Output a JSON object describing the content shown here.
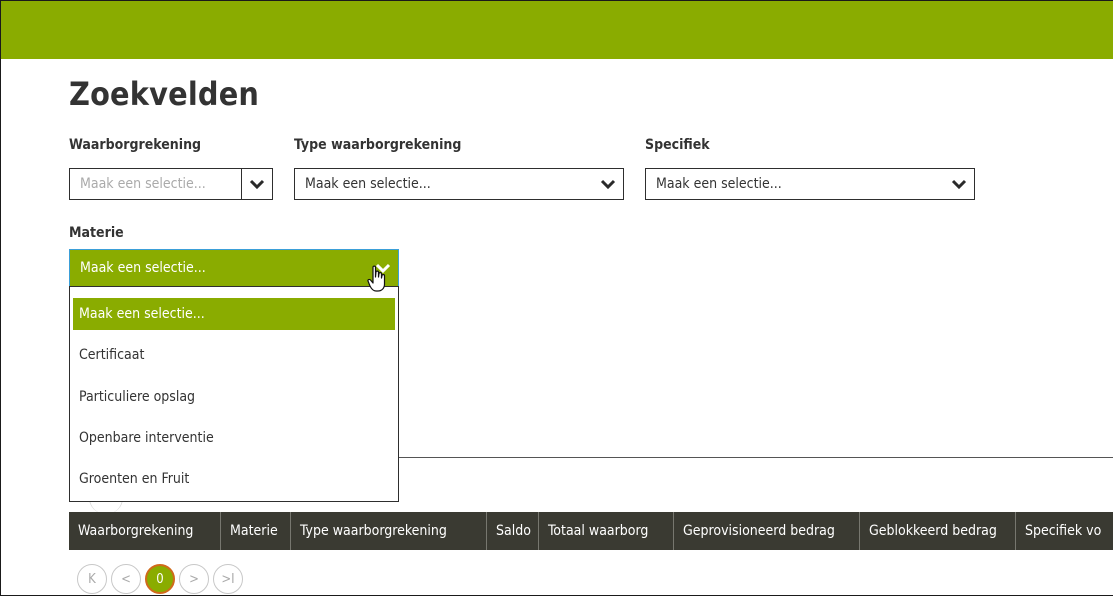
{
  "page": {
    "title": "Zoekvelden"
  },
  "colors": {
    "brand_green": "#8aac00",
    "header_dark": "#3a3a32",
    "focus_blue": "#3b9fd8",
    "current_page_border": "#d06a1a"
  },
  "filters": {
    "waarborgrekening": {
      "label": "Waarborgrekening",
      "placeholder": "Maak een selectie..."
    },
    "type": {
      "label": "Type waarborgrekening",
      "value": "Maak een selectie..."
    },
    "specifiek": {
      "label": "Specifiek",
      "value": "Maak een selectie..."
    },
    "materie": {
      "label": "Materie",
      "value": "Maak een selectie..."
    }
  },
  "materie_options": [
    {
      "label": "Maak een selectie...",
      "selected": true
    },
    {
      "label": "Certificaat"
    },
    {
      "label": "Particuliere opslag"
    },
    {
      "label": "Openbare interventie"
    },
    {
      "label": "Groenten en Fruit"
    }
  ],
  "table": {
    "columns": [
      "Waarborgrekening",
      "Materie",
      "Type waarborgrekening",
      "Saldo",
      "Totaal waarborg",
      "Geprovisioneerd bedrag",
      "Geblokkeerd bedrag",
      "Specifiek vo"
    ]
  },
  "pagination": {
    "first": "K",
    "prev": "<",
    "current": "0",
    "next": ">",
    "last": ">I"
  },
  "icons": {
    "chevron": "chevron-down-icon",
    "cursor": "hand-pointer-icon"
  }
}
